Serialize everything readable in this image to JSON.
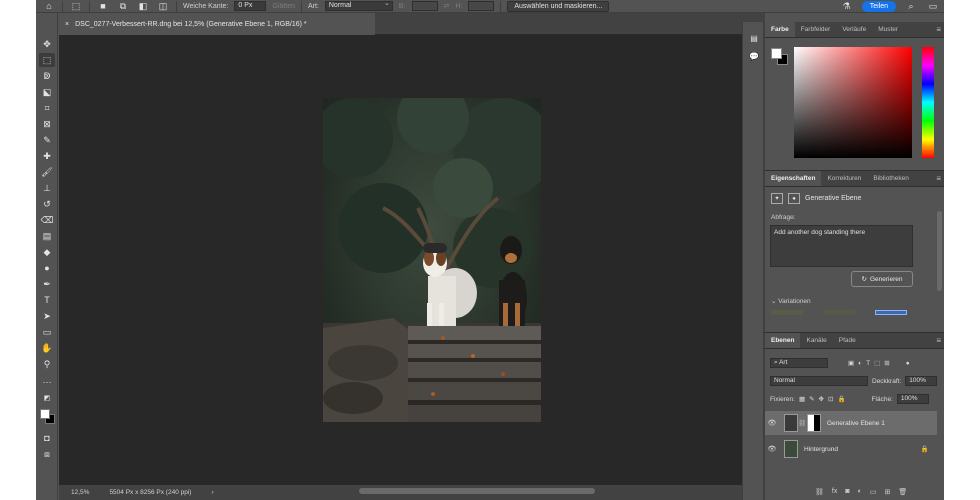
{
  "optionsbar": {
    "feather_label": "Weiche Kante:",
    "feather_value": "0 Px",
    "smooth_label": "Glätten",
    "style_label": "Art:",
    "style_value": "Normal",
    "width_label": "B:",
    "height_label": "H:",
    "select_mask_label": "Auswählen und maskieren...",
    "share_label": "Teilen"
  },
  "document": {
    "tab_title": "DSC_0277-Verbessert-RR.dng bei 12,5% (Generative Ebene 1, RGB/16) *",
    "tab_close": "×"
  },
  "statusbar": {
    "zoom": "12,5%",
    "info": "5504 Px x 8256 Px (240 ppi)",
    "arrow": "›"
  },
  "color_panel": {
    "tabs": [
      "Farbe",
      "Farbfelder",
      "Verläufe",
      "Muster"
    ],
    "fg_color": "#ffffff",
    "bg_color": "#000000"
  },
  "properties_panel": {
    "tabs": [
      "Eigenschaften",
      "Korrekturen",
      "Bibliotheken"
    ],
    "layer_type": "Generative Ebene",
    "prompt_label": "Abfrage:",
    "prompt_text": "Add another dog standing there",
    "generate_label": "Generieren",
    "variations_label": "Variationen"
  },
  "layers_panel": {
    "tabs": [
      "Ebenen",
      "Kanäle",
      "Pfade"
    ],
    "filter_kind": "Art",
    "blend_mode": "Normal",
    "opacity_label": "Deckkraft:",
    "opacity_value": "100%",
    "lock_label": "Fixieren:",
    "fill_label": "Fläche:",
    "fill_value": "100%",
    "layers": [
      {
        "name": "Generative Ebene 1",
        "selected": true
      },
      {
        "name": "Hintergrund",
        "selected": false
      }
    ]
  },
  "accent_color": "#1473e6"
}
